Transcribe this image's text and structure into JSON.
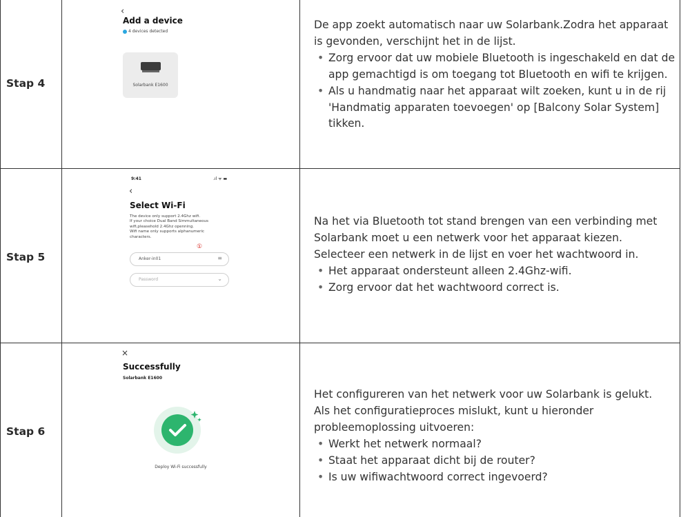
{
  "rows": [
    {
      "step": "Stap 4",
      "phone": {
        "back_icon": "chevron-left-icon",
        "title": "Add a device",
        "detected": "4 devices detected",
        "device_name": "Solarbank E1600"
      },
      "description": {
        "paragraphs": [
          "De app zoekt automatisch naar uw Solarbank.Zodra het apparaat is gevonden, verschijnt het in de lijst."
        ],
        "bullets": [
          "Zorg ervoor dat uw mobiele Bluetooth is ingeschakeld en dat de app gemachtigd is om toegang tot Bluetooth en wifi te krijgen.",
          "Als u handmatig naar het apparaat wilt zoeken, kunt u  in de rij 'Handmatig apparaten toevoegen' op [Balcony Solar System] tikken."
        ]
      }
    },
    {
      "step": "Stap 5",
      "phone": {
        "time": "9:41",
        "status_icons": ".ıl ᯤ ▬",
        "back_icon": "chevron-left-icon",
        "title": "Select Wi-Fi",
        "info_lines": [
          "The device only support 2.4Ghz wifi.",
          "If your choice Dual Band Simmultaneous",
          "wifi,pleasehold 2.4Ghz openning.",
          "Wifi name only supports alphanumeric",
          "characters."
        ],
        "marker": "①",
        "network_value": "Anker-in01",
        "password_placeholder": "Password"
      },
      "description": {
        "paragraphs": [
          "Na het via Bluetooth tot stand brengen van een verbinding met Solarbank moet u een netwerk voor het apparaat kiezen. Selecteer een netwerk in de lijst en voer het wachtwoord in."
        ],
        "bullets": [
          "Het apparaat ondersteunt alleen 2.4Ghz-wifi.",
          "Zorg ervoor dat het wachtwoord correct is."
        ]
      }
    },
    {
      "step": "Stap 6",
      "phone": {
        "close_icon": "close-icon",
        "title": "Successfully",
        "subtitle": "Solarbank E1600",
        "message": "Deploy Wi-Fi successfully"
      },
      "description": {
        "paragraphs": [
          "Het configureren van het netwerk voor uw Solarbank is gelukt.",
          "Als het configuratieproces mislukt, kunt u hieronder probleemoplossing uitvoeren:"
        ],
        "bullets": [
          "Werkt het netwerk normaal?",
          "Staat het apparaat dicht bij de router?",
          "Is uw wifiwachtwoord correct ingevoerd?"
        ]
      }
    }
  ],
  "colors": {
    "accent": "#2aa7e0",
    "success": "#2db56e",
    "marker": "#d9302a",
    "border": "#333333"
  }
}
